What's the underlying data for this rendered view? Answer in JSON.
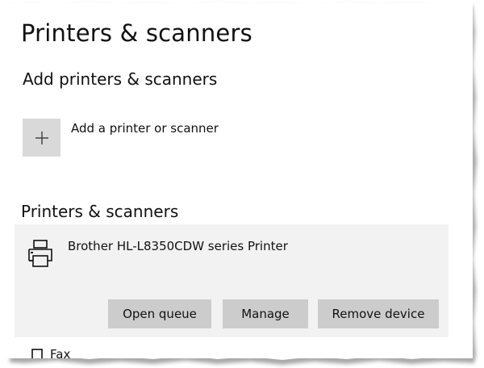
{
  "page": {
    "title": "Printers & scanners"
  },
  "add_section": {
    "title": "Add printers & scanners",
    "add_label": "Add a printer or scanner",
    "add_icon": "plus-icon"
  },
  "list_section": {
    "title": "Printers & scanners",
    "printers": [
      {
        "name": "Brother HL-L8350CDW series Printer",
        "icon": "printer-icon",
        "actions": {
          "open_queue": "Open queue",
          "manage": "Manage",
          "remove": "Remove device"
        }
      }
    ],
    "next_item_partial": "Fax"
  },
  "colors": {
    "tile_bg": "#d9d9d9",
    "card_bg": "#f2f2f2",
    "button_bg": "#cccccc",
    "text": "#111111"
  }
}
